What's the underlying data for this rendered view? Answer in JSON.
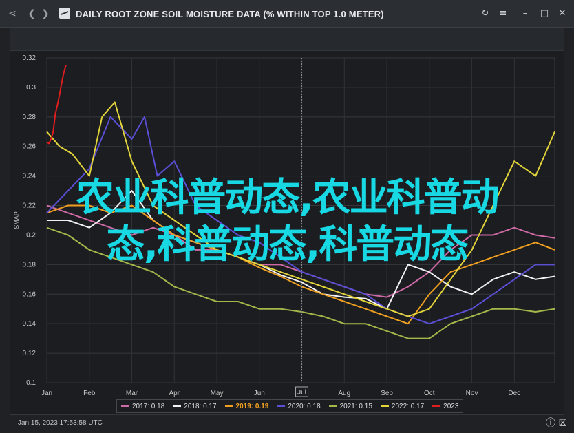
{
  "window": {
    "title": "DAILY ROOT ZONE SOIL MOISTURE DATA (% WITHIN TOP 1.0 METER)",
    "share_icon": "share-icon",
    "back_icon": "chevron-left-icon",
    "forward_icon": "chevron-right-icon",
    "refresh_icon": "refresh-icon",
    "menu_icon": "hamburger-menu-icon"
  },
  "overlay_text": {
    "line1": "农业科普动态,农业科普动",
    "line2": "态,科普动态,科普动态"
  },
  "footer": {
    "date": "Jan 15, 2023 17:53:58 UTC"
  },
  "colors": {
    "2017": "#d06aa6",
    "2018": "#f2f2f2",
    "2019": "#f0a020",
    "2020": "#5b4fd6",
    "2021": "#a4b84a",
    "2022": "#e3d43b",
    "2023": "#e11d1d",
    "overlay": "#17d8e3"
  },
  "chart_data": {
    "type": "line",
    "ylabel": "SMAP",
    "ylim": [
      0.1,
      0.32
    ],
    "yticks": [
      "0.1",
      "0.12",
      "0.14",
      "0.16",
      "0.18",
      "0.2",
      "0.22",
      "0.24",
      "0.26",
      "0.28",
      "0.3",
      "0.32"
    ],
    "months": [
      "Jan",
      "Feb",
      "Mar",
      "Apr",
      "May",
      "Jun",
      "Jul",
      "Aug",
      "Sep",
      "Oct",
      "Nov",
      "Dec"
    ],
    "hover_label": "Jul",
    "series": [
      {
        "name": "2017",
        "legend": "2017: 0.18",
        "color": "#d06aa6",
        "points": [
          [
            0.0,
            0.22
          ],
          [
            0.5,
            0.215
          ],
          [
            1.0,
            0.21
          ],
          [
            1.5,
            0.205
          ],
          [
            2.0,
            0.2
          ],
          [
            2.5,
            0.205
          ],
          [
            3.0,
            0.2
          ],
          [
            3.5,
            0.19
          ],
          [
            4.0,
            0.19
          ],
          [
            4.5,
            0.185
          ],
          [
            5.0,
            0.18
          ],
          [
            5.5,
            0.18
          ],
          [
            6.0,
            0.175
          ],
          [
            6.5,
            0.17
          ],
          [
            7.0,
            0.165
          ],
          [
            7.5,
            0.16
          ],
          [
            8.0,
            0.158
          ],
          [
            8.5,
            0.165
          ],
          [
            9.0,
            0.175
          ],
          [
            9.5,
            0.19
          ],
          [
            10.0,
            0.2
          ],
          [
            10.5,
            0.2
          ],
          [
            11.0,
            0.205
          ],
          [
            11.5,
            0.2
          ],
          [
            11.95,
            0.198
          ]
        ]
      },
      {
        "name": "2018",
        "legend": "2018: 0.17",
        "color": "#f2f2f2",
        "points": [
          [
            0.0,
            0.21
          ],
          [
            0.5,
            0.21
          ],
          [
            1.0,
            0.205
          ],
          [
            1.5,
            0.215
          ],
          [
            2.0,
            0.23
          ],
          [
            2.5,
            0.21
          ],
          [
            3.0,
            0.2
          ],
          [
            3.5,
            0.195
          ],
          [
            4.0,
            0.19
          ],
          [
            4.5,
            0.185
          ],
          [
            5.0,
            0.18
          ],
          [
            5.5,
            0.173
          ],
          [
            6.0,
            0.168
          ],
          [
            6.5,
            0.16
          ],
          [
            7.0,
            0.158
          ],
          [
            7.5,
            0.157
          ],
          [
            8.0,
            0.15
          ],
          [
            8.5,
            0.18
          ],
          [
            9.0,
            0.175
          ],
          [
            9.5,
            0.165
          ],
          [
            10.0,
            0.16
          ],
          [
            10.5,
            0.17
          ],
          [
            11.0,
            0.175
          ],
          [
            11.5,
            0.17
          ],
          [
            11.95,
            0.172
          ]
        ]
      },
      {
        "name": "2019",
        "legend": "2019: 0.19",
        "color": "#f0a020",
        "points": [
          [
            0.0,
            0.215
          ],
          [
            0.5,
            0.22
          ],
          [
            1.0,
            0.22
          ],
          [
            1.5,
            0.215
          ],
          [
            2.0,
            0.22
          ],
          [
            2.5,
            0.21
          ],
          [
            3.0,
            0.2
          ],
          [
            3.5,
            0.195
          ],
          [
            4.0,
            0.19
          ],
          [
            4.5,
            0.185
          ],
          [
            5.0,
            0.178
          ],
          [
            5.5,
            0.172
          ],
          [
            6.0,
            0.165
          ],
          [
            6.5,
            0.16
          ],
          [
            7.0,
            0.155
          ],
          [
            7.5,
            0.15
          ],
          [
            8.0,
            0.145
          ],
          [
            8.5,
            0.14
          ],
          [
            9.0,
            0.16
          ],
          [
            9.5,
            0.175
          ],
          [
            10.0,
            0.18
          ],
          [
            10.5,
            0.185
          ],
          [
            11.0,
            0.19
          ],
          [
            11.5,
            0.195
          ],
          [
            11.95,
            0.19
          ]
        ]
      },
      {
        "name": "2020",
        "legend": "2020: 0.18",
        "color": "#5b4fd6",
        "points": [
          [
            0.0,
            0.215
          ],
          [
            0.5,
            0.23
          ],
          [
            1.0,
            0.245
          ],
          [
            1.5,
            0.28
          ],
          [
            2.0,
            0.265
          ],
          [
            2.3,
            0.28
          ],
          [
            2.6,
            0.24
          ],
          [
            3.0,
            0.25
          ],
          [
            3.5,
            0.22
          ],
          [
            4.0,
            0.21
          ],
          [
            4.5,
            0.2
          ],
          [
            5.0,
            0.195
          ],
          [
            5.5,
            0.185
          ],
          [
            6.0,
            0.175
          ],
          [
            6.5,
            0.17
          ],
          [
            7.0,
            0.165
          ],
          [
            7.5,
            0.16
          ],
          [
            8.0,
            0.15
          ],
          [
            8.5,
            0.145
          ],
          [
            9.0,
            0.14
          ],
          [
            9.5,
            0.145
          ],
          [
            10.0,
            0.15
          ],
          [
            10.5,
            0.16
          ],
          [
            11.0,
            0.17
          ],
          [
            11.5,
            0.18
          ],
          [
            11.95,
            0.18
          ]
        ]
      },
      {
        "name": "2021",
        "legend": "2021: 0.15",
        "color": "#a4b84a",
        "points": [
          [
            0.0,
            0.205
          ],
          [
            0.5,
            0.2
          ],
          [
            1.0,
            0.19
          ],
          [
            1.5,
            0.185
          ],
          [
            2.0,
            0.18
          ],
          [
            2.5,
            0.175
          ],
          [
            3.0,
            0.165
          ],
          [
            3.5,
            0.16
          ],
          [
            4.0,
            0.155
          ],
          [
            4.5,
            0.155
          ],
          [
            5.0,
            0.15
          ],
          [
            5.5,
            0.15
          ],
          [
            6.0,
            0.148
          ],
          [
            6.5,
            0.145
          ],
          [
            7.0,
            0.14
          ],
          [
            7.5,
            0.14
          ],
          [
            8.0,
            0.135
          ],
          [
            8.5,
            0.13
          ],
          [
            9.0,
            0.13
          ],
          [
            9.5,
            0.14
          ],
          [
            10.0,
            0.145
          ],
          [
            10.5,
            0.15
          ],
          [
            11.0,
            0.15
          ],
          [
            11.5,
            0.148
          ],
          [
            11.95,
            0.15
          ]
        ]
      },
      {
        "name": "2022",
        "legend": "2022: 0.17",
        "color": "#e3d43b",
        "points": [
          [
            0.0,
            0.27
          ],
          [
            0.3,
            0.26
          ],
          [
            0.6,
            0.255
          ],
          [
            1.0,
            0.24
          ],
          [
            1.3,
            0.28
          ],
          [
            1.6,
            0.29
          ],
          [
            2.0,
            0.25
          ],
          [
            2.5,
            0.22
          ],
          [
            3.0,
            0.21
          ],
          [
            3.5,
            0.2
          ],
          [
            4.0,
            0.19
          ],
          [
            4.5,
            0.185
          ],
          [
            5.0,
            0.18
          ],
          [
            5.5,
            0.175
          ],
          [
            6.0,
            0.17
          ],
          [
            6.5,
            0.165
          ],
          [
            7.0,
            0.16
          ],
          [
            7.5,
            0.155
          ],
          [
            8.0,
            0.15
          ],
          [
            8.5,
            0.145
          ],
          [
            9.0,
            0.15
          ],
          [
            9.5,
            0.17
          ],
          [
            10.0,
            0.19
          ],
          [
            10.5,
            0.22
          ],
          [
            11.0,
            0.25
          ],
          [
            11.5,
            0.24
          ],
          [
            11.95,
            0.27
          ]
        ]
      },
      {
        "name": "2023",
        "legend": "2023",
        "color": "#e11d1d",
        "points": [
          [
            0.0,
            0.263
          ],
          [
            0.05,
            0.262
          ],
          [
            0.1,
            0.265
          ],
          [
            0.15,
            0.27
          ],
          [
            0.2,
            0.282
          ],
          [
            0.25,
            0.288
          ],
          [
            0.3,
            0.295
          ],
          [
            0.35,
            0.303
          ],
          [
            0.4,
            0.31
          ],
          [
            0.45,
            0.315
          ]
        ]
      }
    ]
  }
}
